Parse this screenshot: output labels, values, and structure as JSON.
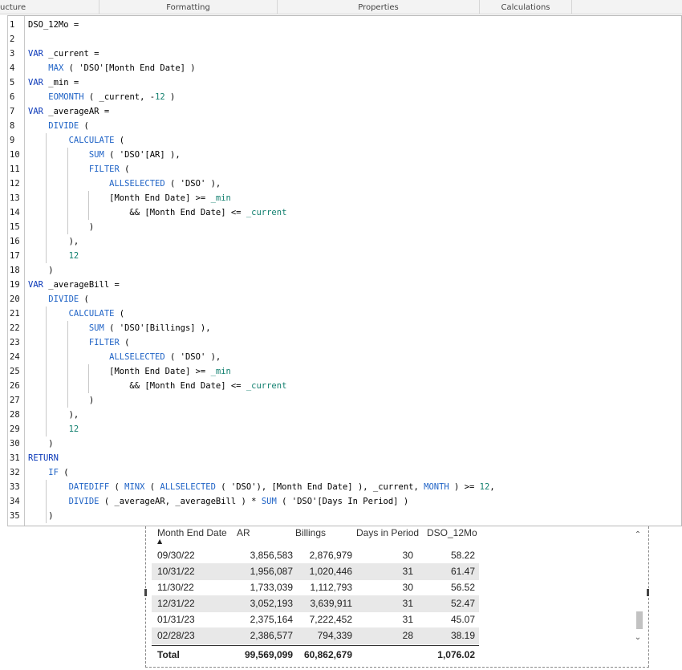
{
  "ribbon": {
    "tabs": [
      "ucture",
      "Formatting",
      "Properties",
      "Calculations"
    ]
  },
  "editor": {
    "lines": [
      {
        "n": "1",
        "parts": [
          [
            "DSO_12Mo =",
            ""
          ]
        ]
      },
      {
        "n": "2",
        "parts": []
      },
      {
        "n": "3",
        "parts": [
          [
            "VAR",
            "kw"
          ],
          [
            " _current =",
            ""
          ]
        ]
      },
      {
        "n": "4",
        "parts": [
          [
            "    ",
            ""
          ],
          [
            "MAX",
            "fn"
          ],
          [
            " ( 'DSO'[Month End Date] )",
            ""
          ]
        ]
      },
      {
        "n": "5",
        "parts": [
          [
            "VAR",
            "kw"
          ],
          [
            " _min =",
            ""
          ]
        ]
      },
      {
        "n": "6",
        "parts": [
          [
            "    ",
            ""
          ],
          [
            "EOMONTH",
            "fn"
          ],
          [
            " ( _current, -",
            ""
          ],
          [
            "12",
            "num"
          ],
          [
            " )",
            ""
          ]
        ]
      },
      {
        "n": "7",
        "parts": [
          [
            "VAR",
            "kw"
          ],
          [
            " _averageAR =",
            ""
          ]
        ]
      },
      {
        "n": "8",
        "parts": [
          [
            "    ",
            ""
          ],
          [
            "DIVIDE",
            "fn"
          ],
          [
            " (",
            ""
          ]
        ]
      },
      {
        "n": "9",
        "parts": [
          [
            "        ",
            ""
          ],
          [
            "CALCULATE",
            "fn"
          ],
          [
            " (",
            ""
          ]
        ]
      },
      {
        "n": "10",
        "parts": [
          [
            "            ",
            ""
          ],
          [
            "SUM",
            "fn"
          ],
          [
            " ( 'DSO'[AR] ),",
            ""
          ]
        ]
      },
      {
        "n": "11",
        "parts": [
          [
            "            ",
            ""
          ],
          [
            "FILTER",
            "fn"
          ],
          [
            " (",
            ""
          ]
        ]
      },
      {
        "n": "12",
        "parts": [
          [
            "                ",
            ""
          ],
          [
            "ALLSELECTED",
            "fn"
          ],
          [
            " ( 'DSO' ),",
            ""
          ]
        ]
      },
      {
        "n": "13",
        "parts": [
          [
            "                [Month End Date] >= ",
            ""
          ],
          [
            "_min",
            "vr"
          ]
        ]
      },
      {
        "n": "14",
        "parts": [
          [
            "                    && [Month End Date] <= ",
            ""
          ],
          [
            "_current",
            "vr"
          ]
        ]
      },
      {
        "n": "15",
        "parts": [
          [
            "            )",
            ""
          ]
        ]
      },
      {
        "n": "16",
        "parts": [
          [
            "        ),",
            ""
          ]
        ]
      },
      {
        "n": "17",
        "parts": [
          [
            "        ",
            ""
          ],
          [
            "12",
            "num"
          ]
        ]
      },
      {
        "n": "18",
        "parts": [
          [
            "    )",
            ""
          ]
        ]
      },
      {
        "n": "19",
        "parts": [
          [
            "VAR",
            "kw"
          ],
          [
            " _averageBill =",
            ""
          ]
        ]
      },
      {
        "n": "20",
        "parts": [
          [
            "    ",
            ""
          ],
          [
            "DIVIDE",
            "fn"
          ],
          [
            " (",
            ""
          ]
        ]
      },
      {
        "n": "21",
        "parts": [
          [
            "        ",
            ""
          ],
          [
            "CALCULATE",
            "fn"
          ],
          [
            " (",
            ""
          ]
        ]
      },
      {
        "n": "22",
        "parts": [
          [
            "            ",
            ""
          ],
          [
            "SUM",
            "fn"
          ],
          [
            " ( 'DSO'[Billings] ),",
            ""
          ]
        ]
      },
      {
        "n": "23",
        "parts": [
          [
            "            ",
            ""
          ],
          [
            "FILTER",
            "fn"
          ],
          [
            " (",
            ""
          ]
        ]
      },
      {
        "n": "24",
        "parts": [
          [
            "                ",
            ""
          ],
          [
            "ALLSELECTED",
            "fn"
          ],
          [
            " ( 'DSO' ),",
            ""
          ]
        ]
      },
      {
        "n": "25",
        "parts": [
          [
            "                [Month End Date] >= ",
            ""
          ],
          [
            "_min",
            "vr"
          ]
        ]
      },
      {
        "n": "26",
        "parts": [
          [
            "                    && [Month End Date] <= ",
            ""
          ],
          [
            "_current",
            "vr"
          ]
        ]
      },
      {
        "n": "27",
        "parts": [
          [
            "            )",
            ""
          ]
        ]
      },
      {
        "n": "28",
        "parts": [
          [
            "        ),",
            ""
          ]
        ]
      },
      {
        "n": "29",
        "parts": [
          [
            "        ",
            ""
          ],
          [
            "12",
            "num"
          ]
        ]
      },
      {
        "n": "30",
        "parts": [
          [
            "    )",
            ""
          ]
        ]
      },
      {
        "n": "31",
        "parts": [
          [
            "RETURN",
            "kw"
          ]
        ]
      },
      {
        "n": "32",
        "parts": [
          [
            "    ",
            ""
          ],
          [
            "IF",
            "fn"
          ],
          [
            " (",
            ""
          ]
        ]
      },
      {
        "n": "33",
        "parts": [
          [
            "        ",
            ""
          ],
          [
            "DATEDIFF",
            "fn"
          ],
          [
            " ( ",
            ""
          ],
          [
            "MINX",
            "fn"
          ],
          [
            " ( ",
            ""
          ],
          [
            "ALLSELECTED",
            "fn"
          ],
          [
            " ( 'DSO'), [Month End Date] ), _current, ",
            ""
          ],
          [
            "MONTH",
            "fn"
          ],
          [
            " ) >= ",
            ""
          ],
          [
            "12",
            "num"
          ],
          [
            ",",
            ""
          ]
        ]
      },
      {
        "n": "34",
        "parts": [
          [
            "        ",
            ""
          ],
          [
            "DIVIDE",
            "fn"
          ],
          [
            " ( _averageAR, _averageBill ) * ",
            ""
          ],
          [
            "SUM",
            "fn"
          ],
          [
            " ( 'DSO'[Days In Period] )",
            ""
          ]
        ]
      },
      {
        "n": "35",
        "parts": [
          [
            "    )",
            ""
          ]
        ]
      }
    ]
  },
  "table": {
    "columns": [
      "Month End Date",
      "AR",
      "Billings",
      "Days in Period",
      "DSO_12Mo"
    ],
    "sort_indicator": "▲",
    "rows": [
      [
        "09/30/22",
        "3,856,583",
        "2,876,979",
        "30",
        "58.22"
      ],
      [
        "10/31/22",
        "1,956,087",
        "1,020,446",
        "31",
        "61.47"
      ],
      [
        "11/30/22",
        "1,733,039",
        "1,112,793",
        "30",
        "56.52"
      ],
      [
        "12/31/22",
        "3,052,193",
        "3,639,911",
        "31",
        "52.47"
      ],
      [
        "01/31/23",
        "2,375,164",
        "7,222,452",
        "31",
        "45.07"
      ],
      [
        "02/28/23",
        "2,386,577",
        "794,339",
        "28",
        "38.19"
      ]
    ],
    "total": [
      "Total",
      "99,569,099",
      "60,862,679",
      "",
      "1,076.02"
    ],
    "scroll_up": "⌃",
    "scroll_down": "⌄"
  }
}
